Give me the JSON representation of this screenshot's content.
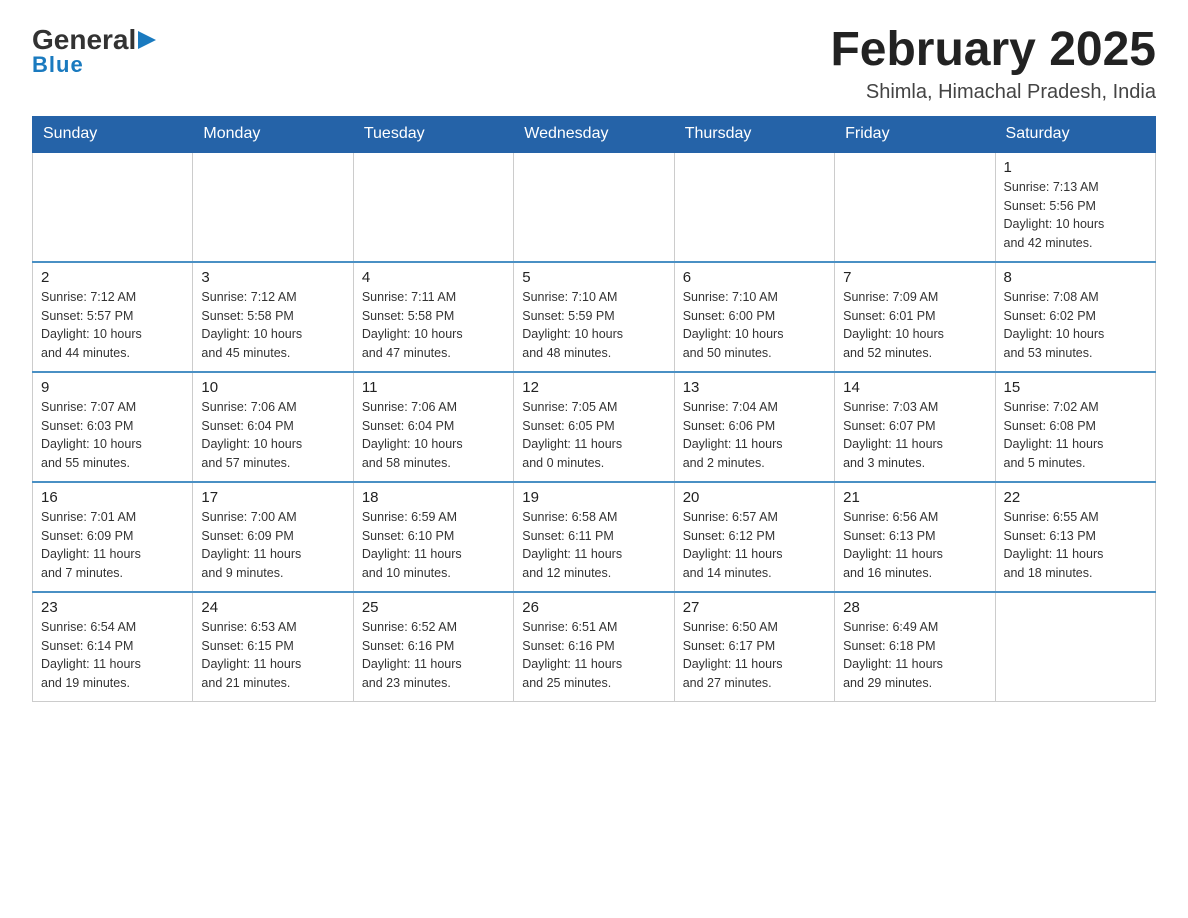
{
  "logo": {
    "general": "General",
    "arrow": "",
    "blue": "Blue"
  },
  "title": "February 2025",
  "subtitle": "Shimla, Himachal Pradesh, India",
  "weekdays": [
    "Sunday",
    "Monday",
    "Tuesday",
    "Wednesday",
    "Thursday",
    "Friday",
    "Saturday"
  ],
  "weeks": [
    [
      {
        "day": "",
        "info": ""
      },
      {
        "day": "",
        "info": ""
      },
      {
        "day": "",
        "info": ""
      },
      {
        "day": "",
        "info": ""
      },
      {
        "day": "",
        "info": ""
      },
      {
        "day": "",
        "info": ""
      },
      {
        "day": "1",
        "info": "Sunrise: 7:13 AM\nSunset: 5:56 PM\nDaylight: 10 hours\nand 42 minutes."
      }
    ],
    [
      {
        "day": "2",
        "info": "Sunrise: 7:12 AM\nSunset: 5:57 PM\nDaylight: 10 hours\nand 44 minutes."
      },
      {
        "day": "3",
        "info": "Sunrise: 7:12 AM\nSunset: 5:58 PM\nDaylight: 10 hours\nand 45 minutes."
      },
      {
        "day": "4",
        "info": "Sunrise: 7:11 AM\nSunset: 5:58 PM\nDaylight: 10 hours\nand 47 minutes."
      },
      {
        "day": "5",
        "info": "Sunrise: 7:10 AM\nSunset: 5:59 PM\nDaylight: 10 hours\nand 48 minutes."
      },
      {
        "day": "6",
        "info": "Sunrise: 7:10 AM\nSunset: 6:00 PM\nDaylight: 10 hours\nand 50 minutes."
      },
      {
        "day": "7",
        "info": "Sunrise: 7:09 AM\nSunset: 6:01 PM\nDaylight: 10 hours\nand 52 minutes."
      },
      {
        "day": "8",
        "info": "Sunrise: 7:08 AM\nSunset: 6:02 PM\nDaylight: 10 hours\nand 53 minutes."
      }
    ],
    [
      {
        "day": "9",
        "info": "Sunrise: 7:07 AM\nSunset: 6:03 PM\nDaylight: 10 hours\nand 55 minutes."
      },
      {
        "day": "10",
        "info": "Sunrise: 7:06 AM\nSunset: 6:04 PM\nDaylight: 10 hours\nand 57 minutes."
      },
      {
        "day": "11",
        "info": "Sunrise: 7:06 AM\nSunset: 6:04 PM\nDaylight: 10 hours\nand 58 minutes."
      },
      {
        "day": "12",
        "info": "Sunrise: 7:05 AM\nSunset: 6:05 PM\nDaylight: 11 hours\nand 0 minutes."
      },
      {
        "day": "13",
        "info": "Sunrise: 7:04 AM\nSunset: 6:06 PM\nDaylight: 11 hours\nand 2 minutes."
      },
      {
        "day": "14",
        "info": "Sunrise: 7:03 AM\nSunset: 6:07 PM\nDaylight: 11 hours\nand 3 minutes."
      },
      {
        "day": "15",
        "info": "Sunrise: 7:02 AM\nSunset: 6:08 PM\nDaylight: 11 hours\nand 5 minutes."
      }
    ],
    [
      {
        "day": "16",
        "info": "Sunrise: 7:01 AM\nSunset: 6:09 PM\nDaylight: 11 hours\nand 7 minutes."
      },
      {
        "day": "17",
        "info": "Sunrise: 7:00 AM\nSunset: 6:09 PM\nDaylight: 11 hours\nand 9 minutes."
      },
      {
        "day": "18",
        "info": "Sunrise: 6:59 AM\nSunset: 6:10 PM\nDaylight: 11 hours\nand 10 minutes."
      },
      {
        "day": "19",
        "info": "Sunrise: 6:58 AM\nSunset: 6:11 PM\nDaylight: 11 hours\nand 12 minutes."
      },
      {
        "day": "20",
        "info": "Sunrise: 6:57 AM\nSunset: 6:12 PM\nDaylight: 11 hours\nand 14 minutes."
      },
      {
        "day": "21",
        "info": "Sunrise: 6:56 AM\nSunset: 6:13 PM\nDaylight: 11 hours\nand 16 minutes."
      },
      {
        "day": "22",
        "info": "Sunrise: 6:55 AM\nSunset: 6:13 PM\nDaylight: 11 hours\nand 18 minutes."
      }
    ],
    [
      {
        "day": "23",
        "info": "Sunrise: 6:54 AM\nSunset: 6:14 PM\nDaylight: 11 hours\nand 19 minutes."
      },
      {
        "day": "24",
        "info": "Sunrise: 6:53 AM\nSunset: 6:15 PM\nDaylight: 11 hours\nand 21 minutes."
      },
      {
        "day": "25",
        "info": "Sunrise: 6:52 AM\nSunset: 6:16 PM\nDaylight: 11 hours\nand 23 minutes."
      },
      {
        "day": "26",
        "info": "Sunrise: 6:51 AM\nSunset: 6:16 PM\nDaylight: 11 hours\nand 25 minutes."
      },
      {
        "day": "27",
        "info": "Sunrise: 6:50 AM\nSunset: 6:17 PM\nDaylight: 11 hours\nand 27 minutes."
      },
      {
        "day": "28",
        "info": "Sunrise: 6:49 AM\nSunset: 6:18 PM\nDaylight: 11 hours\nand 29 minutes."
      },
      {
        "day": "",
        "info": ""
      }
    ]
  ]
}
